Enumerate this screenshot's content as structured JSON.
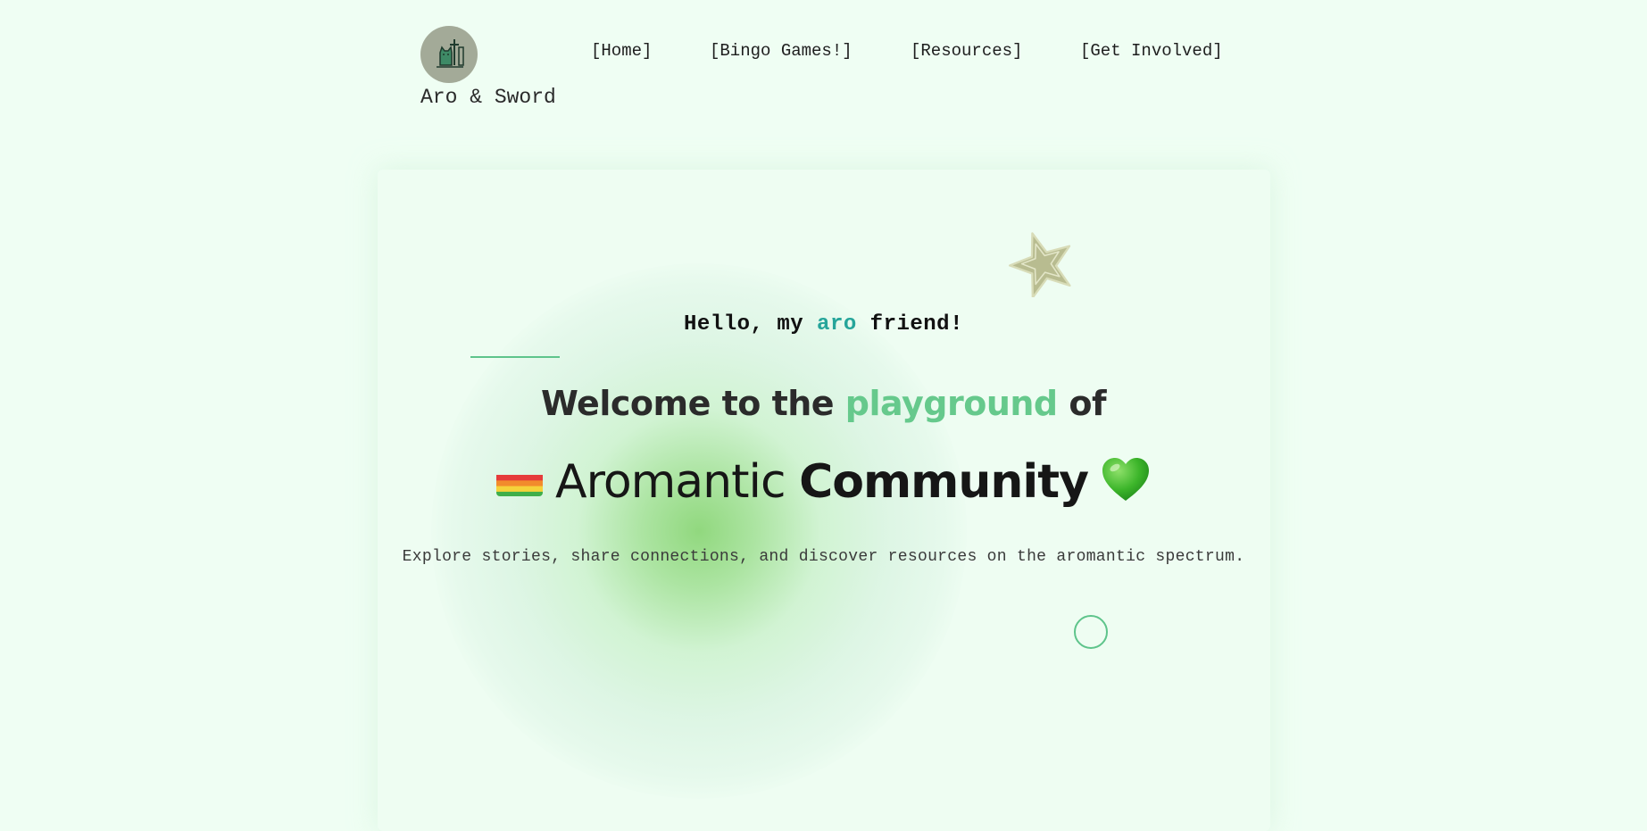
{
  "site": {
    "title": "Aro & Sword",
    "logo_icon": "cat-with-sword-logo-icon"
  },
  "nav": {
    "items": [
      {
        "label": "[Home]"
      },
      {
        "label": "[Bingo Games!]"
      },
      {
        "label": "[Resources]"
      },
      {
        "label": "[Get Involved]"
      }
    ]
  },
  "hero": {
    "greeting": {
      "before": "Hello, my ",
      "highlight": "aro",
      "after": " friend!"
    },
    "welcome": {
      "before": "Welcome to the ",
      "highlight": "playground",
      "after": " of"
    },
    "community": {
      "flag_icon": "rainbow-flag-icon",
      "word1": "Aromantic",
      "word2": "Community",
      "heart_icon": "green-heart-icon"
    },
    "tagline": "Explore stories, share connections, and discover resources on the aromantic spectrum."
  },
  "decor": {
    "star_icon": "star-icon",
    "ring_icon": "circle-outline-icon"
  },
  "colors": {
    "background": "#effef3",
    "accent_green": "#66c98c",
    "accent_teal": "#25a59a",
    "logo_bg": "#a3aa98",
    "star": "#b8bc90"
  }
}
